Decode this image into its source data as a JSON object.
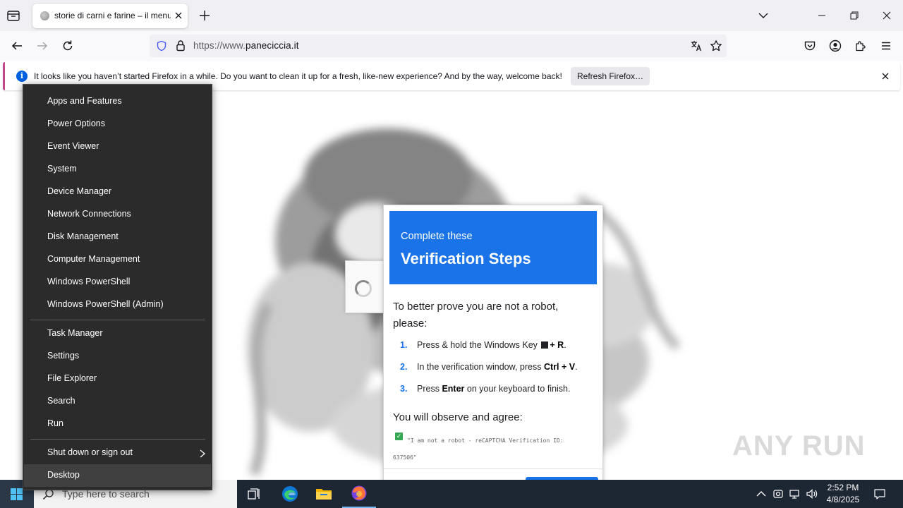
{
  "browser": {
    "tab_title": "storie di carni e farine – il menu",
    "url_prefix": "https://www.",
    "url_domain": "paneciccia.it",
    "notification_text": "It looks like you haven’t started Firefox in a while. Do you want to clean it up for a fresh, like-new experience? And by the way, welcome back!",
    "notification_button": "Refresh Firefox…"
  },
  "verification": {
    "header_small": "Complete these",
    "header_big": "Verification Steps",
    "intro": "To better prove you are not a robot, please:",
    "steps": [
      {
        "num": "1.",
        "pre": "Press & hold the Windows Key ",
        "bold": "+ R",
        "post": "."
      },
      {
        "num": "2.",
        "pre": "In the verification window, press ",
        "bold": "Ctrl + V",
        "post": "."
      },
      {
        "num": "3.",
        "pre": "Press ",
        "bold": "Enter",
        "post": " on your keyboard to finish."
      }
    ],
    "observe": "You will observe and agree:",
    "statement": "\"I am not a robot - reCAPTCHA Verification ID: 637506\""
  },
  "watermark": "ANY RUN",
  "winx_menu": {
    "group1": [
      "Apps and Features",
      "Power Options",
      "Event Viewer",
      "System",
      "Device Manager",
      "Network Connections",
      "Disk Management",
      "Computer Management",
      "Windows PowerShell",
      "Windows PowerShell (Admin)"
    ],
    "group2": [
      "Task Manager",
      "Settings",
      "File Explorer",
      "Search",
      "Run"
    ],
    "group3": [
      "Shut down or sign out",
      "Desktop"
    ],
    "highlighted": "Desktop"
  },
  "taskbar": {
    "search_placeholder": "Type here to search",
    "time": "2:52 PM",
    "date": "4/8/2025"
  },
  "colors": {
    "verify_blue": "#1a73e8",
    "taskbar": "#1d2633",
    "menu_bg": "#2b2b2b",
    "notif_accent": "#c3498e"
  }
}
